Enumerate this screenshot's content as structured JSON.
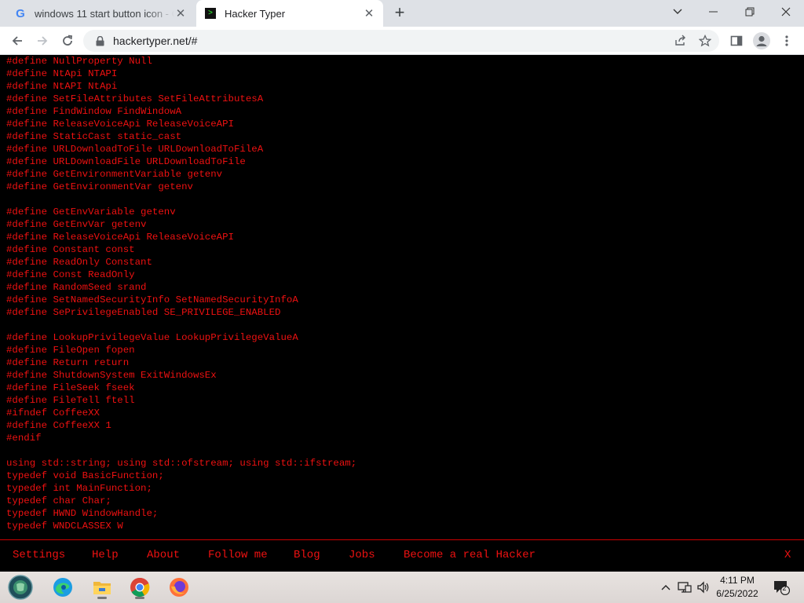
{
  "browser": {
    "tabs": [
      {
        "title": "windows 11 start button icon - Google Search",
        "active": false,
        "favicon": "google-g-icon"
      },
      {
        "title": "Hacker Typer",
        "active": true,
        "favicon": "terminal-icon"
      }
    ],
    "url": "hackertyper.net/#"
  },
  "terminal": {
    "color": "#ee1111",
    "lines": [
      "#define NullProperty Null",
      "#define NtApi NTAPI",
      "#define NtAPI NtApi",
      "#define SetFileAttributes SetFileAttributesA",
      "#define FindWindow FindWindowA",
      "#define ReleaseVoiceApi ReleaseVoiceAPI",
      "#define StaticCast static_cast",
      "#define URLDownloadToFile URLDownloadToFileA",
      "#define URLDownloadFile URLDownloadToFile",
      "#define GetEnvironmentVariable getenv",
      "#define GetEnvironmentVar getenv",
      "",
      "#define GetEnvVariable getenv",
      "#define GetEnvVar getenv",
      "#define ReleaseVoiceApi ReleaseVoiceAPI",
      "#define Constant const",
      "#define ReadOnly Constant",
      "#define Const ReadOnly",
      "#define RandomSeed srand",
      "#define SetNamedSecurityInfo SetNamedSecurityInfoA",
      "#define SePrivilegeEnabled SE_PRIVILEGE_ENABLED",
      "",
      "#define LookupPrivilegeValue LookupPrivilegeValueA",
      "#define FileOpen fopen",
      "#define Return return",
      "#define ShutdownSystem ExitWindowsEx",
      "#define FileSeek fseek",
      "#define FileTell ftell",
      "#ifndef CoffeeXX",
      "#define CoffeeXX 1",
      "#endif",
      "",
      "using std::string; using std::ofstream; using std::ifstream;",
      "typedef void BasicFunction;",
      "typedef int MainFunction;",
      "typedef char Char;",
      "typedef HWND WindowHandle;",
      "typedef WNDCLASSEX W"
    ]
  },
  "menu": {
    "items": [
      "Settings",
      "Help",
      "About",
      "Follow me",
      "Blog",
      "Jobs",
      "Become a real Hacker"
    ],
    "close": "X"
  },
  "taskbar": {
    "apps": [
      "start-orb-icon",
      "edge-icon",
      "file-explorer-icon",
      "chrome-icon",
      "firefox-icon"
    ],
    "time": "4:11 PM",
    "date": "6/25/2022",
    "notification_count": "2"
  }
}
